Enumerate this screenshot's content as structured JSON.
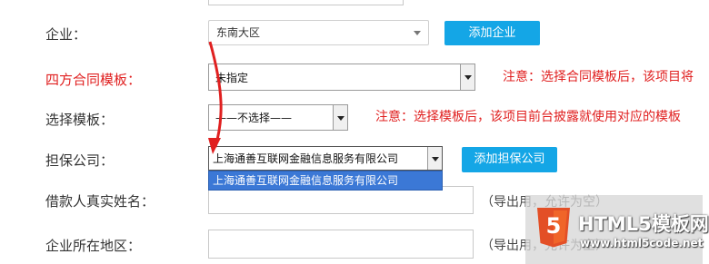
{
  "form": {
    "enterprise": {
      "label": "企业：",
      "value": "东南大区",
      "add_button": "添加企业"
    },
    "four_party_template": {
      "label": "四方合同模板：",
      "value": "未指定",
      "note": "注意：选择合同模板后，该项目将"
    },
    "select_template": {
      "label": "选择模板：",
      "value": "——不选择——",
      "note": "注意：选择模板后，该项目前台披露就使用对应的模板"
    },
    "guarantee_company": {
      "label": "担保公司：",
      "value": "上海通善互联网金融信息服务有限公司",
      "add_button": "添加担保公司",
      "dropdown_options": [
        "上海通善互联网金融信息服务有限公司"
      ]
    },
    "borrower_name": {
      "label": "借款人真实姓名：",
      "value": "",
      "hint": "（导出用，允许为空）"
    },
    "enterprise_region": {
      "label": "企业所在地区：",
      "value": "",
      "hint": "（导出用，允许为空）"
    }
  },
  "watermark": {
    "badge": "5",
    "title": "HTML5模板网",
    "url": "www.html5code.net"
  },
  "colors": {
    "accent": "#14a6e6",
    "warning": "#e02020",
    "selection": "#3b78d6",
    "watermark_orange": "#e34f26"
  }
}
